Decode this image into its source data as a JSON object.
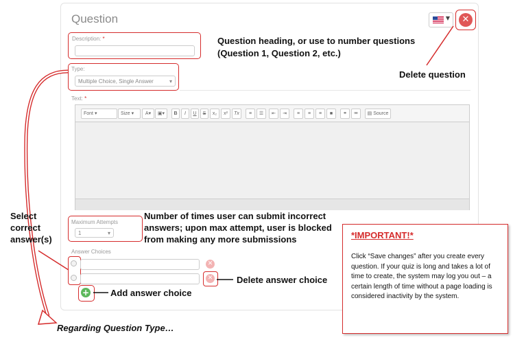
{
  "question": {
    "title": "Question",
    "description_label": "Description:",
    "required_mark": "*",
    "type_label": "Type:",
    "type_value": "Multiple Choice, Single Answer",
    "text_label": "Text:",
    "max_attempts_label": "Maximum Attempts",
    "max_attempts_value": "1",
    "answer_choices_label": "Answer Choices"
  },
  "toolbar": {
    "font": "Font",
    "size": "Size",
    "bold": "B",
    "italic": "I",
    "underline": "U",
    "strike": "S",
    "subscript": "x₂",
    "superscript": "x²",
    "clear_format": "Tx",
    "source": "Source"
  },
  "annotations": {
    "heading_line1": "Question heading, or use to number questions",
    "heading_line2": "(Question 1, Question 2, etc.)",
    "delete_question": "Delete question",
    "max_attempts_line1": "Number of times user can submit incorrect",
    "max_attempts_line2": "answers; upon max attempt, user is blocked",
    "max_attempts_line3": "from making any more submissions",
    "select_correct_line1": "Select",
    "select_correct_line2": "correct",
    "select_correct_line3": "answer(s)",
    "delete_answer": "Delete answer choice",
    "add_answer": "Add answer choice",
    "regarding_type": "Regarding Question Type…"
  },
  "important": {
    "title": "*IMPORTANT!*",
    "body": "Click “Save changes” after you create every question. If your quiz is long and takes a lot of time to create, the system may log you out – a certain length of time without a page loading is considered inactivity by the system."
  },
  "colors": {
    "accent_red": "#d52b2b",
    "add_green": "#5cb85c",
    "delete_red": "#e05757"
  },
  "icons": [
    "us-flag-icon",
    "delete-question-icon",
    "delete-answer-icon",
    "add-answer-icon"
  ]
}
